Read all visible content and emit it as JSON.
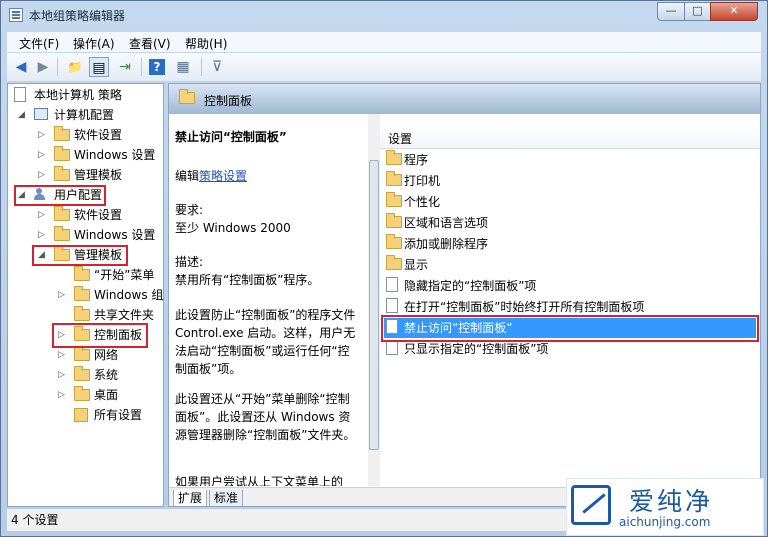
{
  "window": {
    "title": "本地组策略编辑器",
    "min_glyph": "—",
    "max_glyph": "□",
    "close_glyph": "✕"
  },
  "menu": [
    "文件(F)",
    "操作(A)",
    "查看(V)",
    "帮助(H)"
  ],
  "toolbar": {
    "back": "◀",
    "forward": "▶",
    "up": "📁",
    "view": "▤",
    "export": "⇥",
    "help": "?",
    "properties": "▦",
    "filter": "⊽"
  },
  "tree": {
    "root": "本地计算机 策略",
    "computer_config": "计算机配置",
    "cc_software": "软件设置",
    "cc_windows": "Windows 设置",
    "cc_admin": "管理模板",
    "user_config": "用户配置",
    "uc_software": "软件设置",
    "uc_windows": "Windows 设置",
    "uc_admin": "管理模板",
    "start_menu": "“开始”菜单",
    "windows_components": "Windows 组件",
    "shared_folders": "共享文件夹",
    "control_panel": "控制面板",
    "network": "网络",
    "system": "系统",
    "desktop": "桌面",
    "all_settings": "所有设置"
  },
  "content": {
    "header_title": "控制面板",
    "desc_title": "禁止访问“控制面板”",
    "edit_prefix": "编辑",
    "edit_link": "策略设置",
    "requirements_label": "要求:",
    "requirements_value": "至少 Windows 2000",
    "description_label": "描述:",
    "description_line": "禁用所有“控制面板”程序。",
    "para1": "此设置防止“控制面板”的程序文件 Control.exe 启动。这样，用户无法启动“控制面板”或运行任何“控制面板”项。",
    "para2": "此设置还从“开始”菜单删除“控制面板”。此设置还从 Windows 资源管理器删除“控制面板”文件夹。",
    "para3": "如果用户尝试从上下文菜单上的",
    "list_header": "设置",
    "items": [
      "程序",
      "打印机",
      "个性化",
      "区域和语言选项",
      "添加或删除程序",
      "显示",
      "隐藏指定的“控制面板”项",
      "在打开“控制面板”时始终打开所有控制面板项",
      "禁止访问“控制面板”",
      "只显示指定的“控制面板”项"
    ],
    "tabs": [
      "扩展",
      "标准"
    ]
  },
  "status": "4 个设置",
  "watermark": {
    "brand": "爱纯净",
    "domain": "aichunjing.com"
  },
  "colors": {
    "highlight": "#3399ff",
    "annotation": "#d3232f",
    "brand": "#1b5aa8"
  }
}
